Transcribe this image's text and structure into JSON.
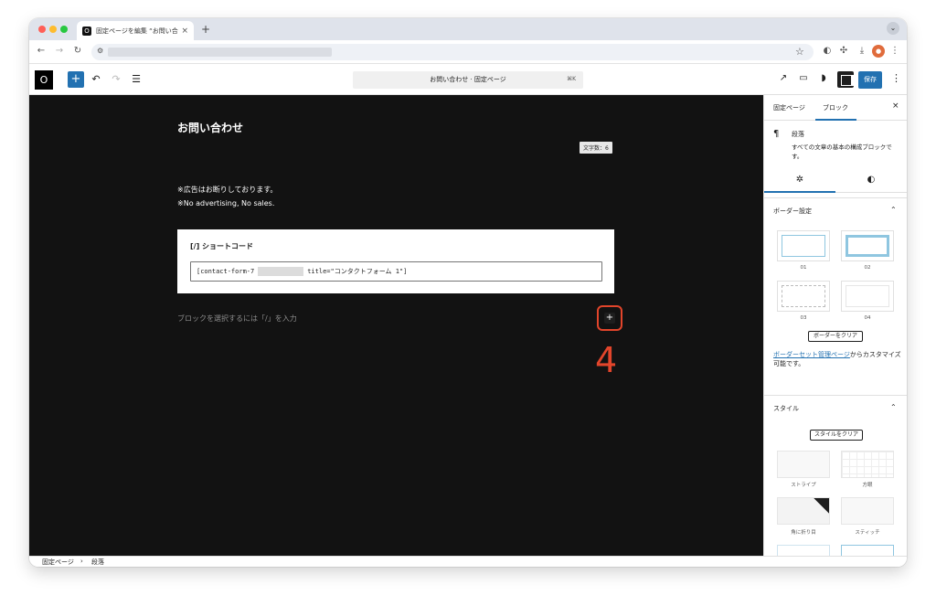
{
  "browser": {
    "tab_favicon": "O",
    "tab_title": "固定ページを編集 “お問い合わせ",
    "tab_close": "×",
    "new_tab": "+",
    "tab_down": "⌄"
  },
  "editor_header": {
    "logo": "O",
    "inserter": "+",
    "command_title": "お問い合わせ · 固定ページ",
    "command_shortcut": "⌘K",
    "save_label": "保存",
    "more": "⋮"
  },
  "canvas": {
    "page_title": "お問い合わせ",
    "char_count": "文字数：6",
    "paragraph_1": "※広告はお断りしております。",
    "paragraph_2": "※No advertising, No sales.",
    "shortcode_label": "[/] ショートコード",
    "shortcode_prefix": "[contact-form-7",
    "shortcode_suffix": "title=\"コンタクトフォーム 1\"]",
    "placeholder": "ブロックを選択するには「/」を入力",
    "append_label": "+",
    "annotation_number": "4"
  },
  "sidebar": {
    "tabs": [
      "固定ページ",
      "ブロック"
    ],
    "close": "×",
    "block_icon": "¶",
    "block_name": "段落",
    "block_desc": "すべての文章の基本の構成ブロックです。",
    "border_panel_title": "ボーダー設定",
    "border_options": [
      "01",
      "02",
      "03",
      "04"
    ],
    "clear_border": "ボーダーをクリア",
    "border_link": "ボーダーセット管理ページ",
    "border_link_suffix": "からカスタマイズ可能です。",
    "style_panel_title": "スタイル",
    "clear_style": "スタイルをクリア",
    "style_options": [
      "ストライプ",
      "方眼",
      "角に折り目",
      "スティッチ"
    ]
  },
  "footer": {
    "breadcrumb": [
      "固定ページ",
      "段落"
    ],
    "separator": "›"
  },
  "colors": {
    "accent": "#2271b1",
    "canvas_bg": "#121212",
    "annotation": "#e2452b"
  }
}
